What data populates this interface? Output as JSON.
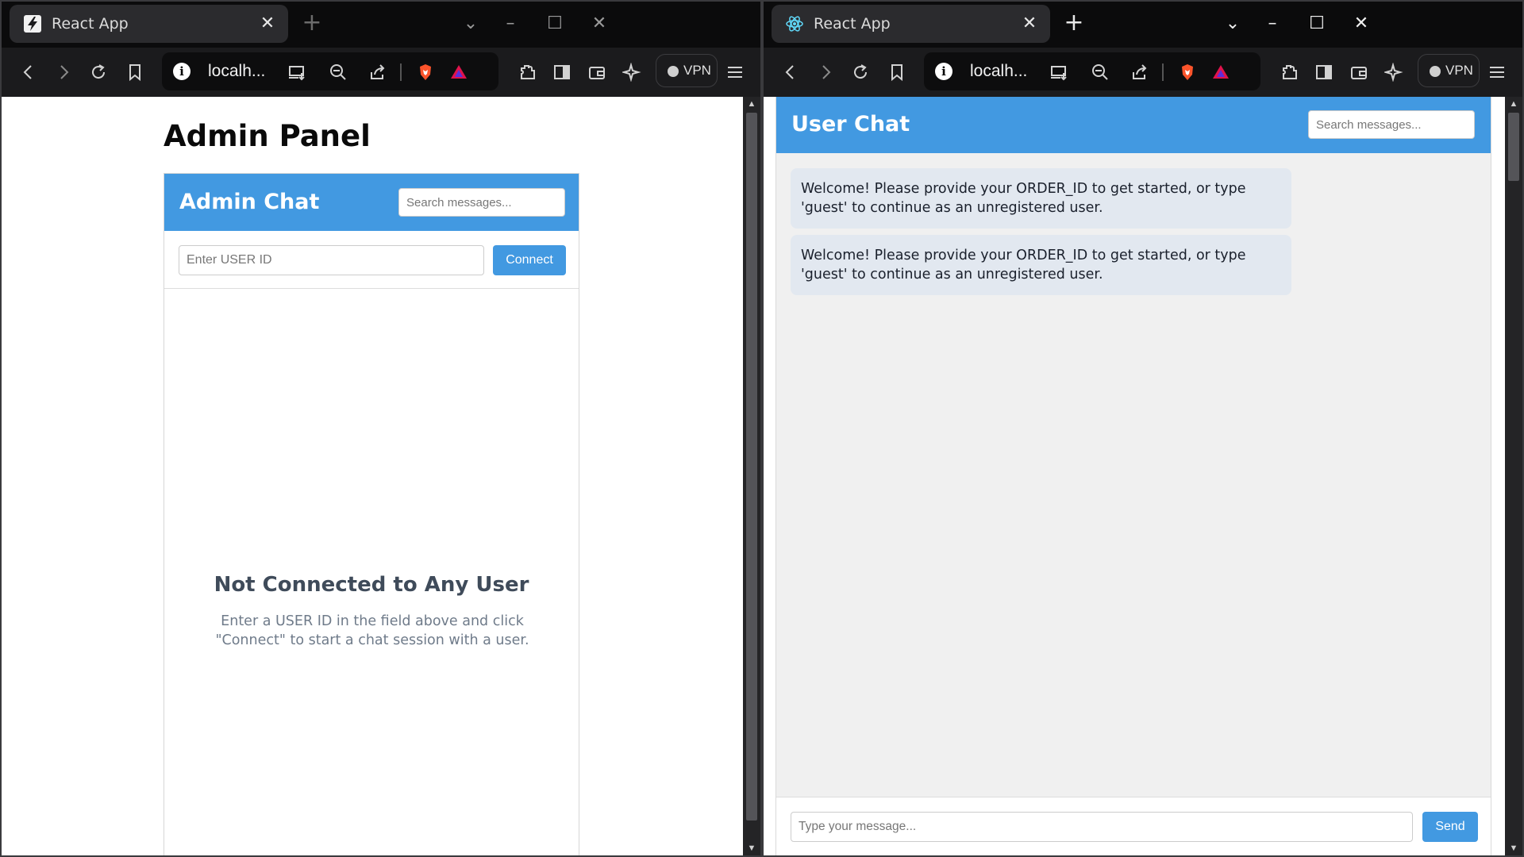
{
  "left_window": {
    "tab": {
      "title": "React App",
      "favicon": "lightning-favicon-icon"
    },
    "address": {
      "url": "localh..."
    },
    "vpn_label": "VPN",
    "page": {
      "title": "Admin Panel",
      "chat": {
        "header_title": "Admin Chat",
        "search_placeholder": "Search messages...",
        "userid_placeholder": "Enter USER ID",
        "connect_label": "Connect",
        "empty_title": "Not Connected to Any User",
        "empty_desc": "Enter a USER ID in the field above and click \"Connect\" to start a chat session with a user."
      }
    }
  },
  "right_window": {
    "tab": {
      "title": "React App",
      "favicon": "react-atom-icon"
    },
    "address": {
      "url": "localh..."
    },
    "vpn_label": "VPN",
    "page": {
      "header_title": "User Chat",
      "search_placeholder": "Search messages...",
      "messages": [
        {
          "text": "Welcome! Please provide your ORDER_ID to get started, or type 'guest' to continue as an unregistered user."
        },
        {
          "text": "Welcome! Please provide your ORDER_ID to get started, or type 'guest' to continue as an unregistered user."
        }
      ],
      "message_placeholder": "Type your message...",
      "send_label": "Send"
    }
  },
  "theme": {
    "accent": "#4299e1",
    "message_bubble": "#e2e8f0",
    "chat_background": "#f0f0f0",
    "browser_dark": "#1b1b1d"
  }
}
